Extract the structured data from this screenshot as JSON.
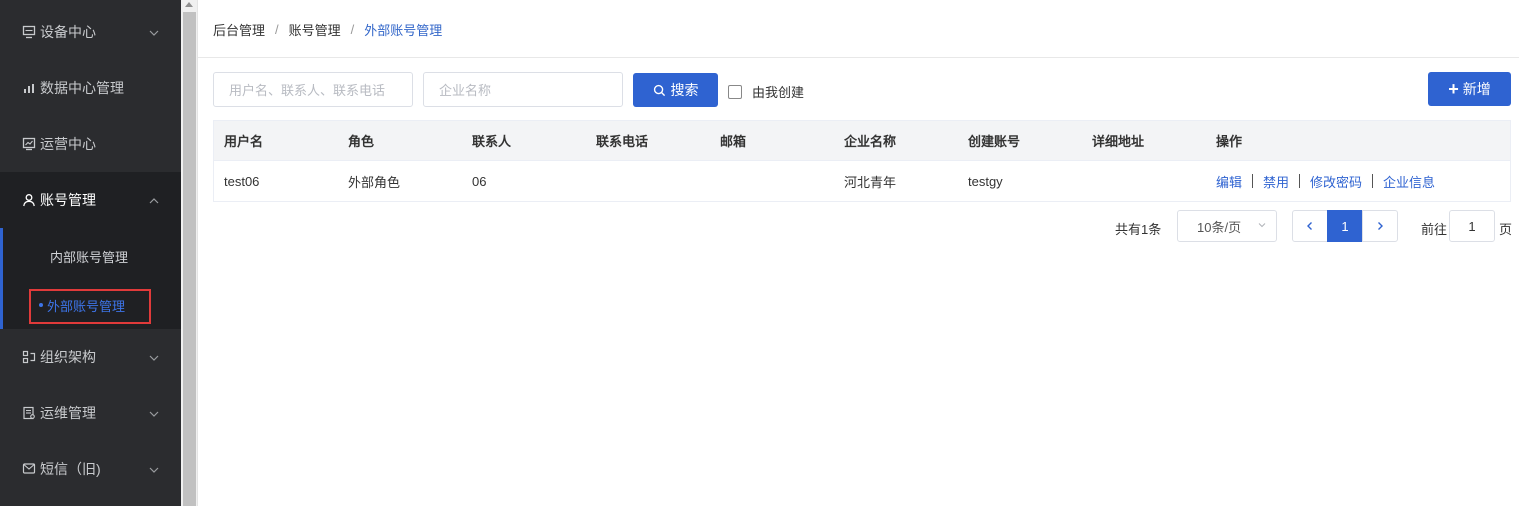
{
  "sidebar": {
    "items": [
      {
        "label": "设备中心",
        "icon": "monitor-icon"
      },
      {
        "label": "数据中心管理",
        "icon": "bar-chart-icon"
      },
      {
        "label": "运营中心",
        "icon": "chart-screen-icon"
      },
      {
        "label": "账号管理",
        "icon": "user-icon"
      },
      {
        "label": "组织架构",
        "icon": "org-structure-icon"
      },
      {
        "label": "运维管理",
        "icon": "document-icon"
      },
      {
        "label": "短信（旧)",
        "icon": "message-icon"
      }
    ],
    "sub_items": [
      {
        "label": "内部账号管理"
      },
      {
        "label": "外部账号管理"
      }
    ],
    "accent_color": "#2f63d1"
  },
  "breadcrumb": {
    "items": [
      "后台管理",
      "账号管理",
      "外部账号管理"
    ],
    "separator": "/"
  },
  "filters": {
    "search_placeholder": "用户名、联系人、联系电话",
    "company_placeholder": "企业名称",
    "search_button": "搜索",
    "created_by_me": "由我创建",
    "add_button": "新增"
  },
  "table": {
    "columns": [
      "用户名",
      "角色",
      "联系人",
      "联系电话",
      "邮箱",
      "企业名称",
      "创建账号",
      "详细地址",
      "操作"
    ],
    "rows": [
      {
        "username": "test06",
        "role": "外部角色",
        "contact": "06",
        "phone": "",
        "email": "",
        "company": "河北青年",
        "creator": "testgy",
        "address": "",
        "ops": [
          "编辑",
          "禁用",
          "修改密码",
          "企业信息"
        ]
      }
    ]
  },
  "pagination": {
    "total_text": "共有1条",
    "page_size": "10条/页",
    "current_page": "1",
    "goto_label": "前往",
    "goto_value": "1",
    "page_suffix": "页"
  }
}
